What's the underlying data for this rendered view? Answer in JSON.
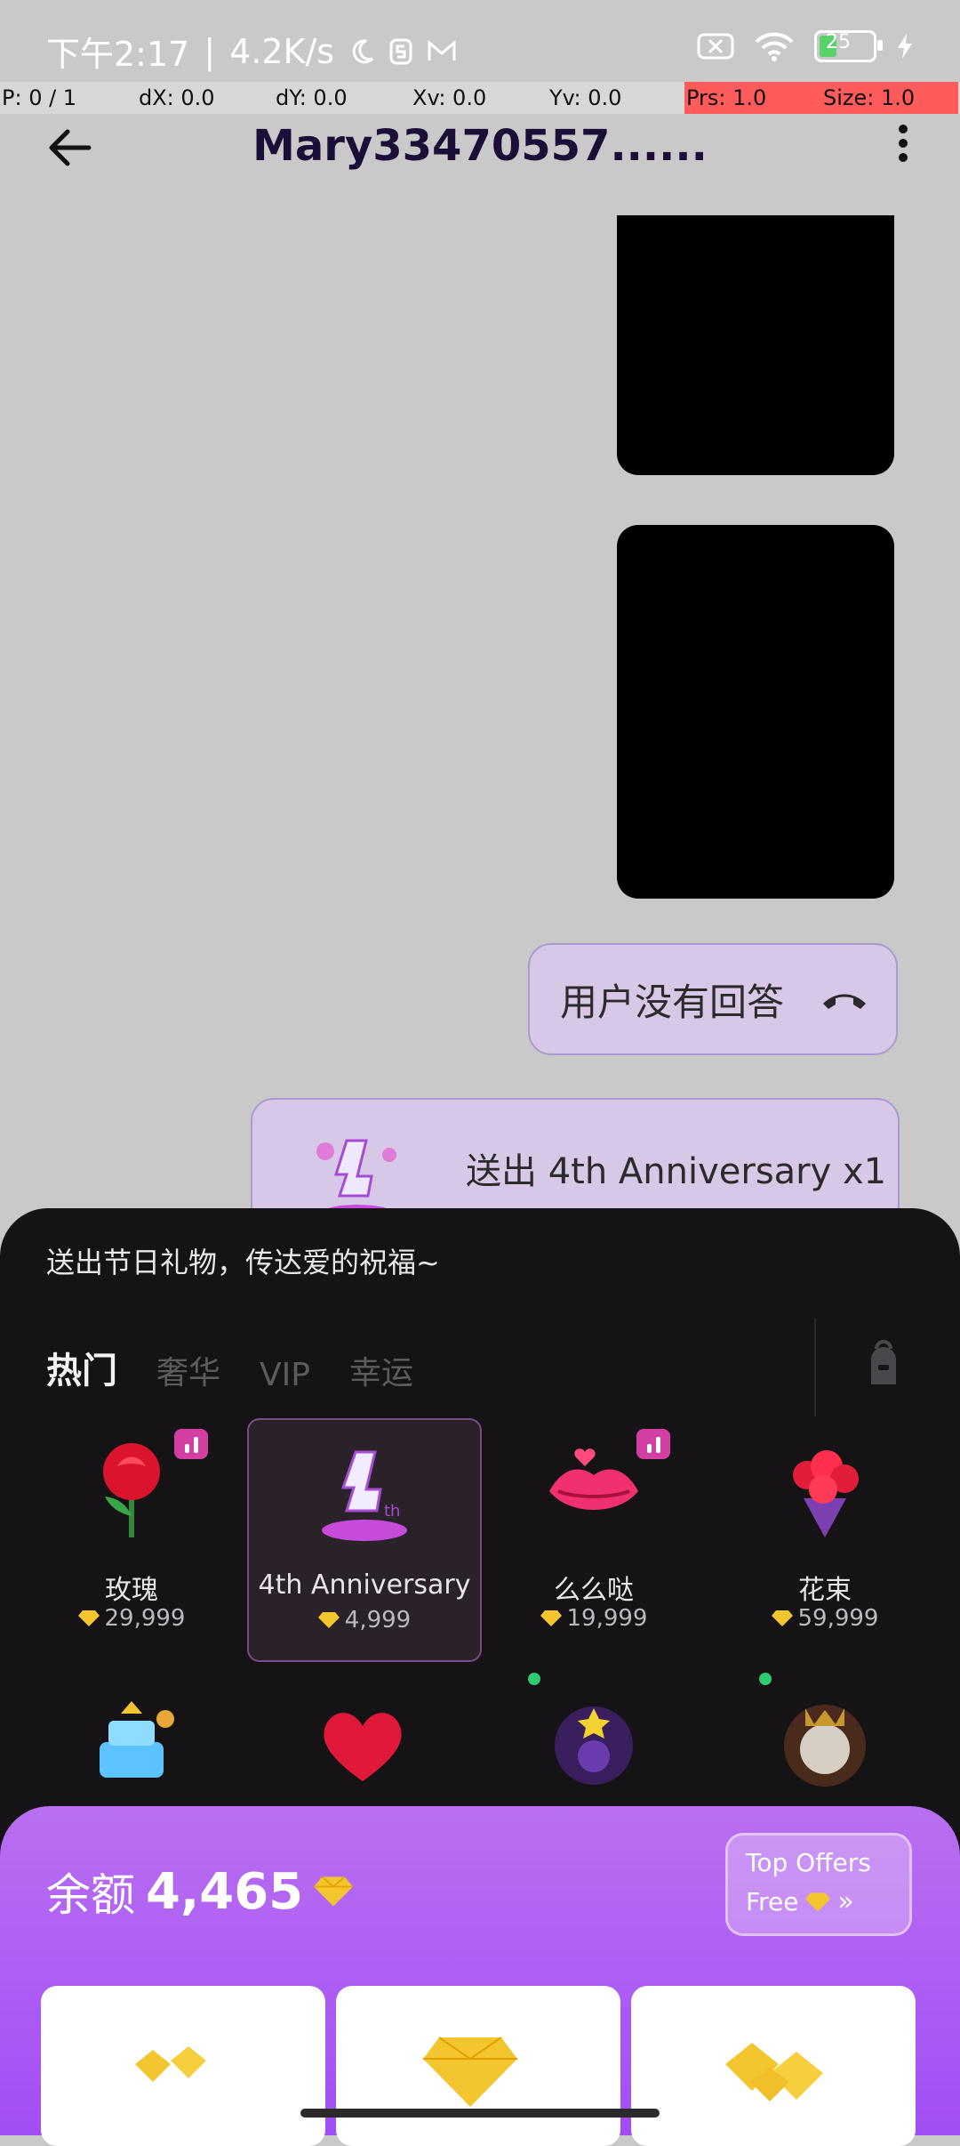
{
  "status": {
    "time": "下午2:17",
    "speed": "4.2K/s",
    "battery": "25"
  },
  "debug": {
    "p": "P: 0 / 1",
    "dx": "dX: 0.0",
    "dy": "dY: 0.0",
    "xv": "Xv: 0.0",
    "yv": "Yv: 0.0",
    "prs": "Prs: 1.0",
    "size": "Size: 1.0"
  },
  "appbar": {
    "title": "Mary33470557......"
  },
  "chat": {
    "call_text": "用户没有回答",
    "gift_text": "送出 4th Anniversary x1"
  },
  "gift_sheet": {
    "hint": "送出节日礼物，传达爱的祝福~",
    "tabs": [
      "热门",
      "奢华",
      "VIP",
      "幸运"
    ],
    "gifts": [
      {
        "name": "玫瑰",
        "price": "29,999"
      },
      {
        "name": "4th Anniversary",
        "price": "4,999"
      },
      {
        "name": "么么哒",
        "price": "19,999"
      },
      {
        "name": "花束",
        "price": "59,999"
      }
    ]
  },
  "topup": {
    "balance_label": "余额",
    "balance_value": "4,465",
    "offers_line1": "Top Offers",
    "offers_line2": "Free"
  },
  "colors": {
    "accent_purple": "#a24ef6",
    "bubble": "#d6c8e6",
    "sheet_bg": "#161316",
    "gem": "#f3c630"
  }
}
